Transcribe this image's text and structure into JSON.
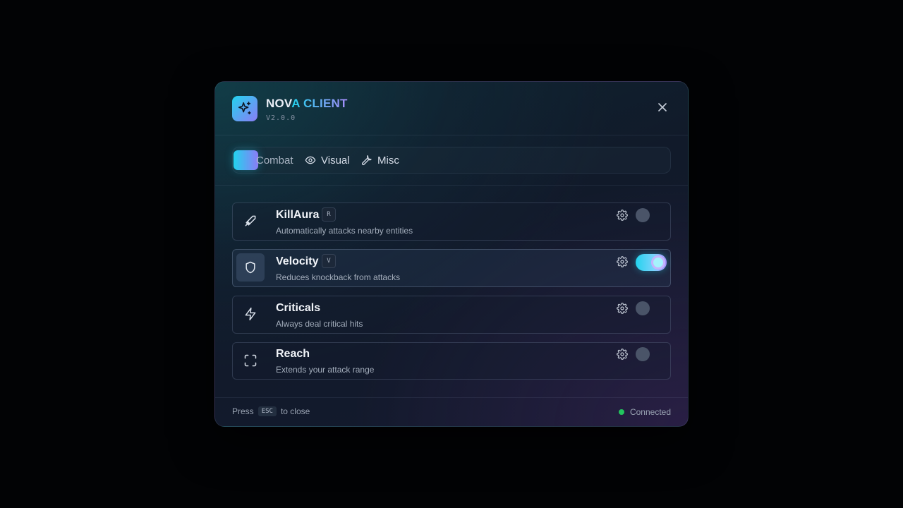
{
  "header": {
    "title_part1": "NOV",
    "title_part2": "A CLIENT",
    "version": "V2.0.0"
  },
  "tabs": [
    {
      "label": "Combat",
      "icon": "crosshair-icon",
      "active": true
    },
    {
      "label": "Visual",
      "icon": "eye-icon",
      "active": false
    },
    {
      "label": "Misc",
      "icon": "wrench-icon",
      "active": false
    }
  ],
  "modules": [
    {
      "name": "KillAura",
      "keybind": "R",
      "description": "Automatically attacks nearby entities",
      "icon": "sword-icon",
      "enabled": false
    },
    {
      "name": "Velocity",
      "keybind": "V",
      "description": "Reduces knockback from attacks",
      "icon": "shield-icon",
      "enabled": true
    },
    {
      "name": "Criticals",
      "keybind": "",
      "description": "Always deal critical hits",
      "icon": "lightning-icon",
      "enabled": false
    },
    {
      "name": "Reach",
      "keybind": "",
      "description": "Extends your attack range",
      "icon": "expand-icon",
      "enabled": false
    }
  ],
  "footer": {
    "press": "Press",
    "key": "ESC",
    "to_close": "to close",
    "status": "Connected"
  },
  "colors": {
    "accent_cyan": "#22d3ee",
    "accent_violet": "#a78bfa",
    "status_green": "#22c55e"
  }
}
